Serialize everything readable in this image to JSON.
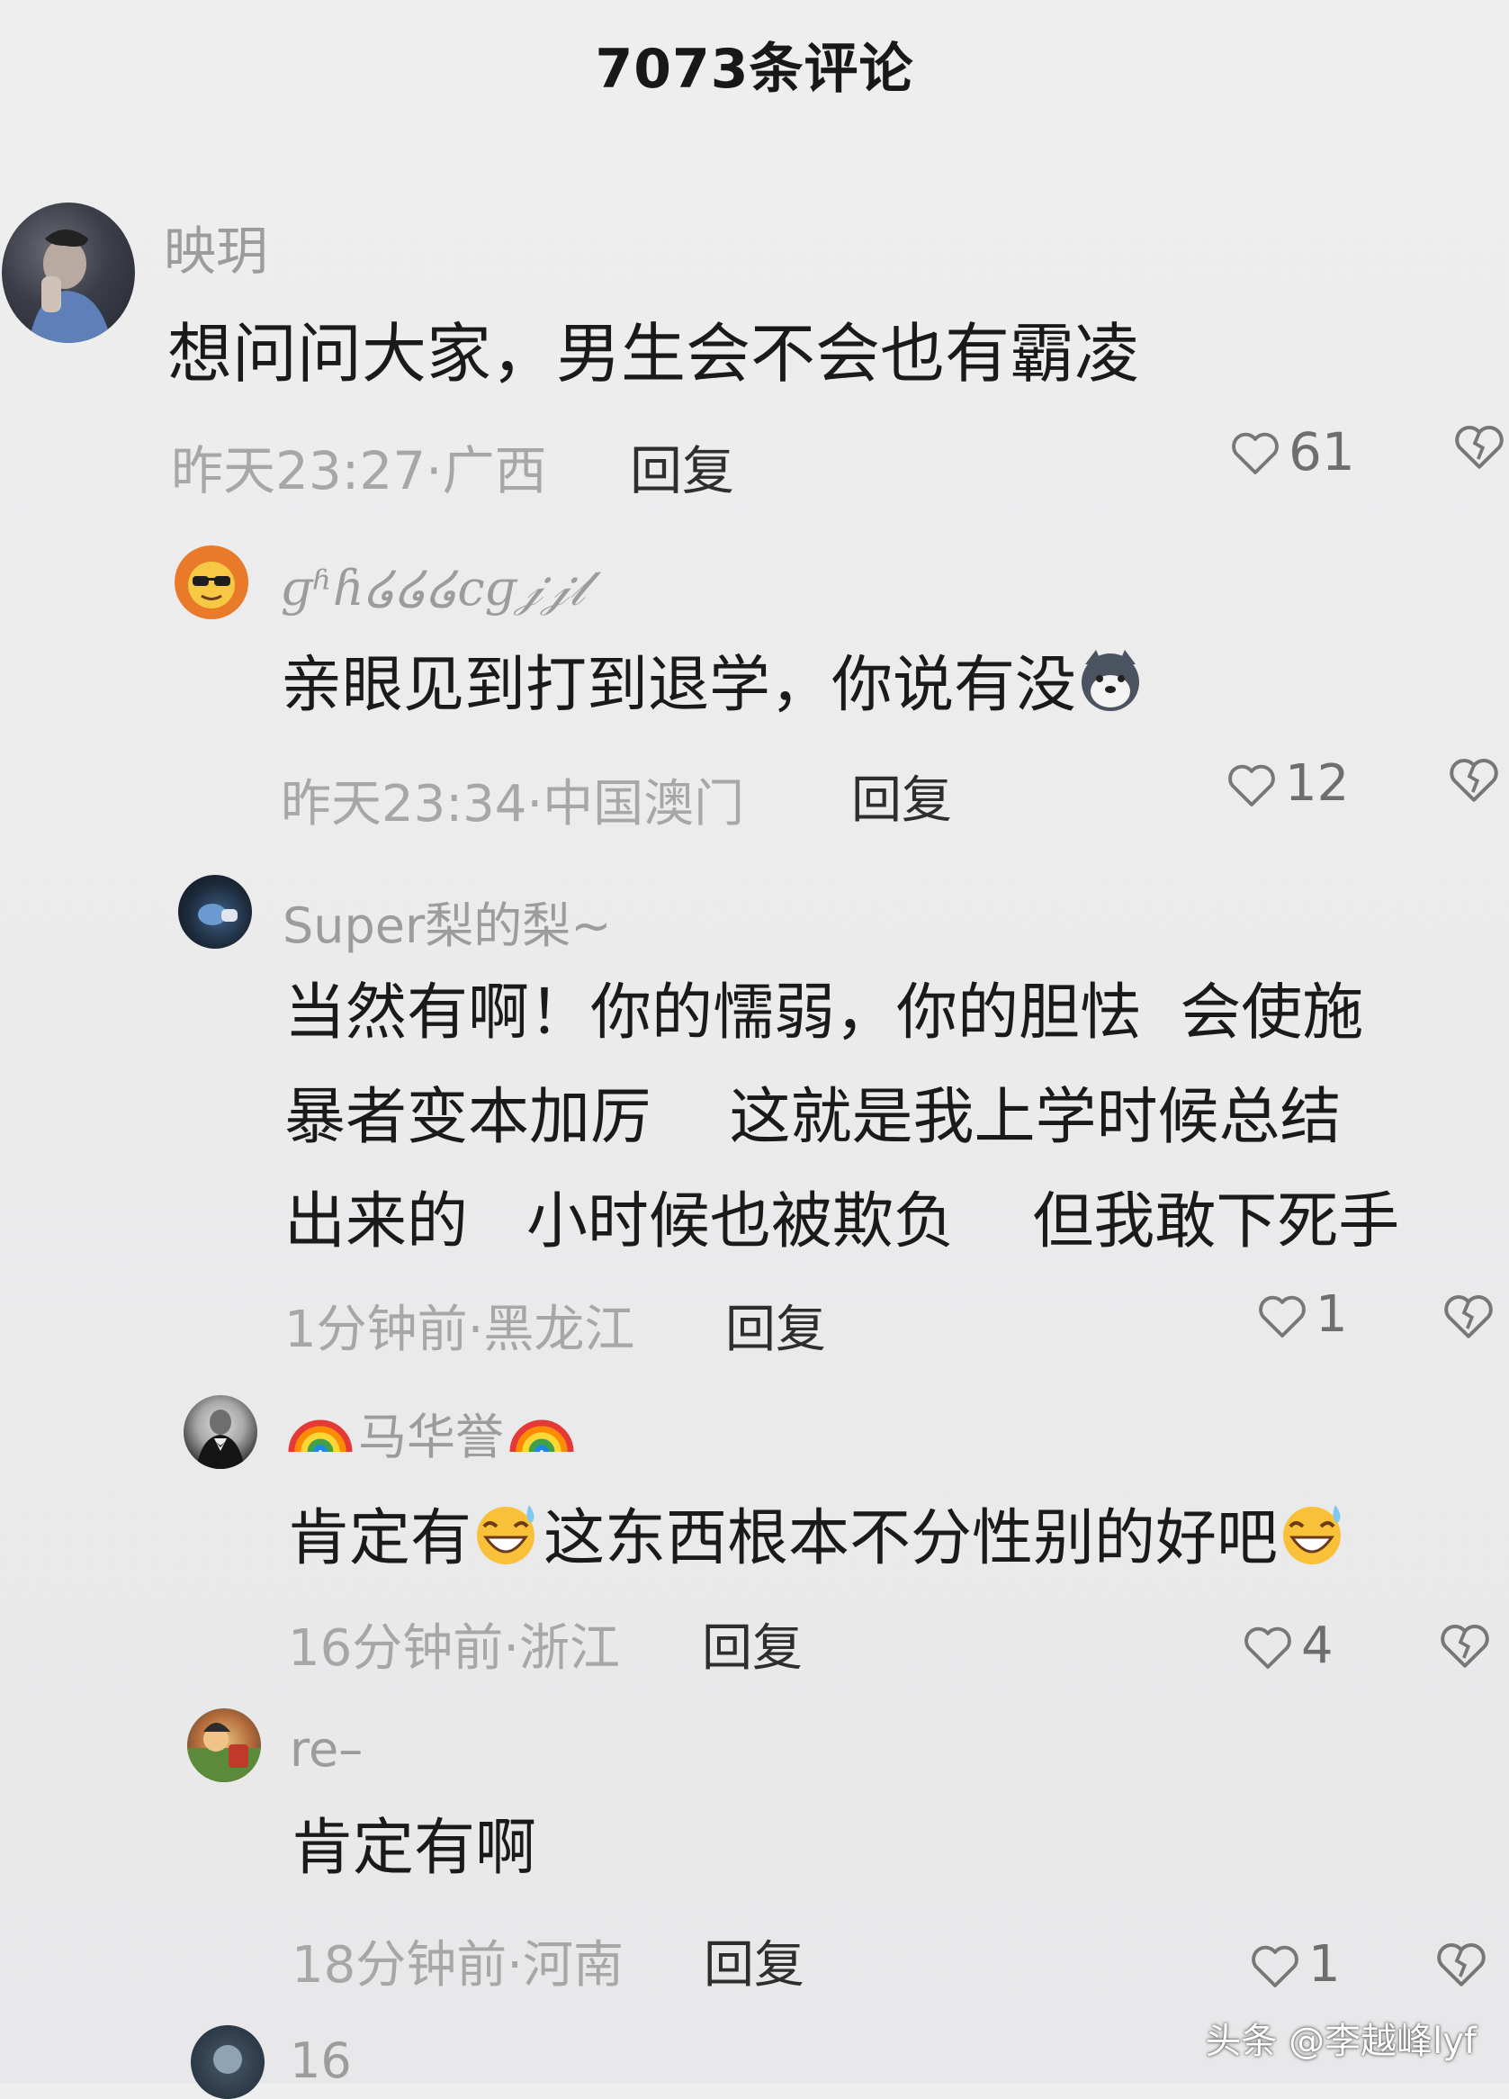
{
  "header": {
    "title": "7073条评论"
  },
  "comments": [
    {
      "username": "映玥",
      "content": "想问问大家，男生会不会也有霸凌",
      "meta": "昨天23:27·广西",
      "reply_label": "回复",
      "likes": "61",
      "avatar_icon": "person-photo-avatar"
    },
    {
      "username": "ɡʱɦ໒໒໒cɡ𝒿𝒿𝓁",
      "content": "亲眼见到打到退学，你说有没",
      "meta": "昨天23:34·中国澳门",
      "reply_label": "回复",
      "likes": "12",
      "avatar_icon": "sunglasses-emoji-avatar",
      "emoji": "husky-dog-emoji"
    },
    {
      "username": "Super梨的梨~",
      "content_lines": [
        "当然有啊！你的懦弱，你的胆怯  会使施",
        "暴者变本加厉    这就是我上学时候总结",
        "出来的   小时候也被欺负    但我敢下死手"
      ],
      "meta": "1分钟前·黑龙江",
      "reply_label": "回复",
      "likes": "1",
      "avatar_icon": "dark-photo-avatar"
    },
    {
      "username": "马华誉",
      "content_a": "肯定有",
      "content_b": "这东西根本不分性别的好吧",
      "meta": "16分钟前·浙江",
      "reply_label": "回复",
      "likes": "4",
      "avatar_icon": "tuxedo-photo-avatar",
      "emoji": "grinning-sweat-emoji",
      "name_icon": "rainbow-emoji"
    },
    {
      "username": "re–",
      "content": "肯定有啊",
      "meta": "18分钟前·河南",
      "reply_label": "回复",
      "likes": "1",
      "avatar_icon": "cartoon-avatar"
    },
    {
      "username": "16",
      "avatar_icon": "partial-avatar"
    }
  ],
  "watermark": "头条 @李越峰lyf",
  "colors": {
    "text": "#1a1a1a",
    "secondary": "#a7a7a7",
    "background": "#ececed"
  }
}
